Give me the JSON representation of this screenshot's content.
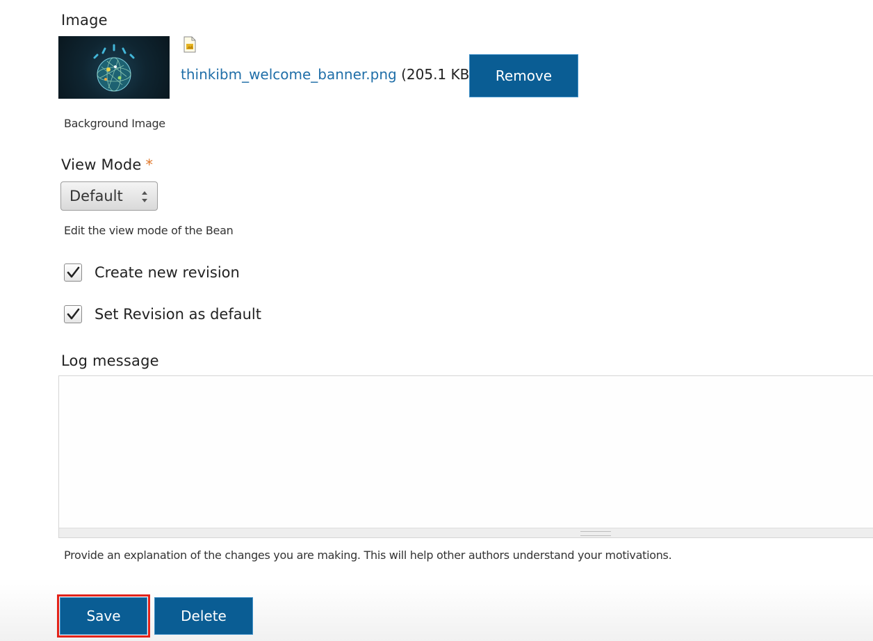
{
  "image_field": {
    "label": "Image",
    "file_name": "thinkibm_welcome_banner.png",
    "file_size": "(205.1 KB)",
    "remove_label": "Remove",
    "description": "Background Image"
  },
  "view_mode": {
    "label": "View Mode",
    "required_marker": "*",
    "selected": "Default",
    "description": "Edit the view mode of the Bean"
  },
  "options": {
    "create_revision_label": "Create new revision",
    "create_revision_checked": true,
    "set_default_label": "Set Revision as default",
    "set_default_checked": true
  },
  "log": {
    "label": "Log message",
    "value": "",
    "description": "Provide an explanation of the changes you are making. This will help other authors understand your motivations."
  },
  "actions": {
    "save_label": "Save",
    "delete_label": "Delete"
  },
  "colors": {
    "button_blue": "#0a5d94",
    "link_blue": "#1f6ea8",
    "required_orange": "#e0772a",
    "highlight_red": "#e2231a"
  }
}
